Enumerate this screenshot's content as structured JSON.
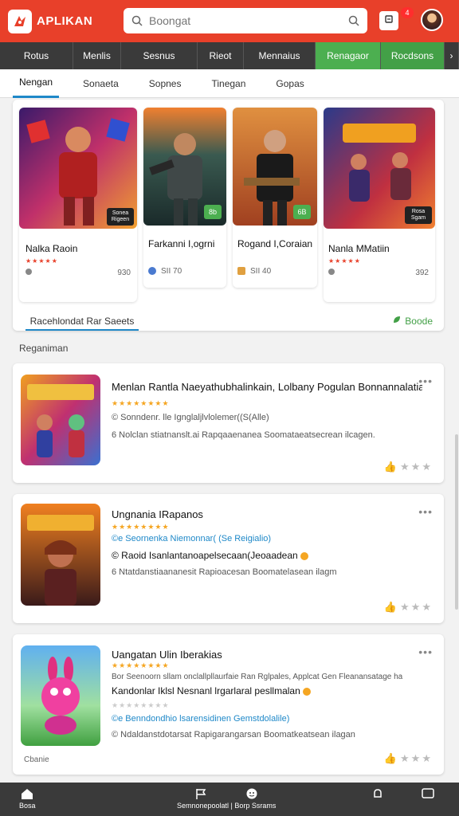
{
  "header": {
    "logo_text": "APLIKAN",
    "search_placeholder": "Boongat",
    "cart_count": "4",
    "colors": {
      "brand": "#e8402a",
      "nav_dark": "#3a3a3a",
      "green": "#4caf50",
      "accent_blue": "#1e88c8"
    }
  },
  "categories": [
    "Rotus",
    "Menlis",
    "Sesnus",
    "Rieot",
    "Mennaius",
    "Renagaor",
    "Rocdsons"
  ],
  "subtabs": {
    "active": "Nengan",
    "items": [
      "Nengan",
      "Sonaeta",
      "Sopnes",
      "Tinegan",
      "Gopas"
    ]
  },
  "featured": {
    "cards": [
      {
        "title": "Nalka Raoin",
        "stars": "★★★★★",
        "meta": "",
        "price": "930",
        "badge": "Sonea Rigeen"
      },
      {
        "title": "Farkanni I,ogrni",
        "stars": "",
        "meta": "SII 70",
        "badge": "8b"
      },
      {
        "title": "Rogand I,Coraian",
        "stars": "",
        "meta": "SII 40",
        "badge": "6B"
      },
      {
        "title": "Nanla MMatiin",
        "stars": "★★★★★",
        "meta": "",
        "price": "392",
        "badge": "Rosa Sgam"
      }
    ],
    "tab_label": "Racehlondat Rar Saeets",
    "more_label": "Boode"
  },
  "section_label": "Reganiman",
  "list": [
    {
      "title": "Menlan Rantla Naeyathubhalinkain, Lolbany Pogulan Bonnannalatian",
      "stars": "★★★★★★★★",
      "line1": "© Sonndenr. lle Ignglaljlvlolemer((S(Alle)",
      "line2": "6 Nolclan stiatnanslt.ai Rapqaaenanea Soomataeatsecrean ilcagen.",
      "rating": "★★★"
    },
    {
      "title": "Ungnania IRapanos",
      "stars": "★★★★★★★★",
      "line1": "©e Seornenka Niemonnar( (Se Reigialio)",
      "line2": "© Raoid Isanlantanoapelsecaan(Jeoaadean",
      "line3": "6 Ntatdanstiaananesit Rapioacesan Boomatelasean ilagm",
      "rating": "★★★"
    },
    {
      "title": "Uangatan Ulin Iberakias",
      "stars": "★★★★★★★★",
      "line1": "Bor Seenoorn sllam onclallpllaurfaie Ran Rglpales, Applcat Gen Fleanansatage ha",
      "line2": "Kandonlar Iklsl Nesnanl lrgarlaral pesllmalan",
      "stars_grey": "★★★★★★★★",
      "line3": "©e Benndondhio lsarensidinen Gemstdolalile)",
      "line4": "© Ndaldanstdotarsat Rapigarangarsan Boomatkeatsean ilagan",
      "footer": "Cbanie",
      "rating": "★★★"
    }
  ],
  "bottom_nav": {
    "home": "Bosa",
    "center": "Semnonepoolatl | Borp Ssrams"
  }
}
